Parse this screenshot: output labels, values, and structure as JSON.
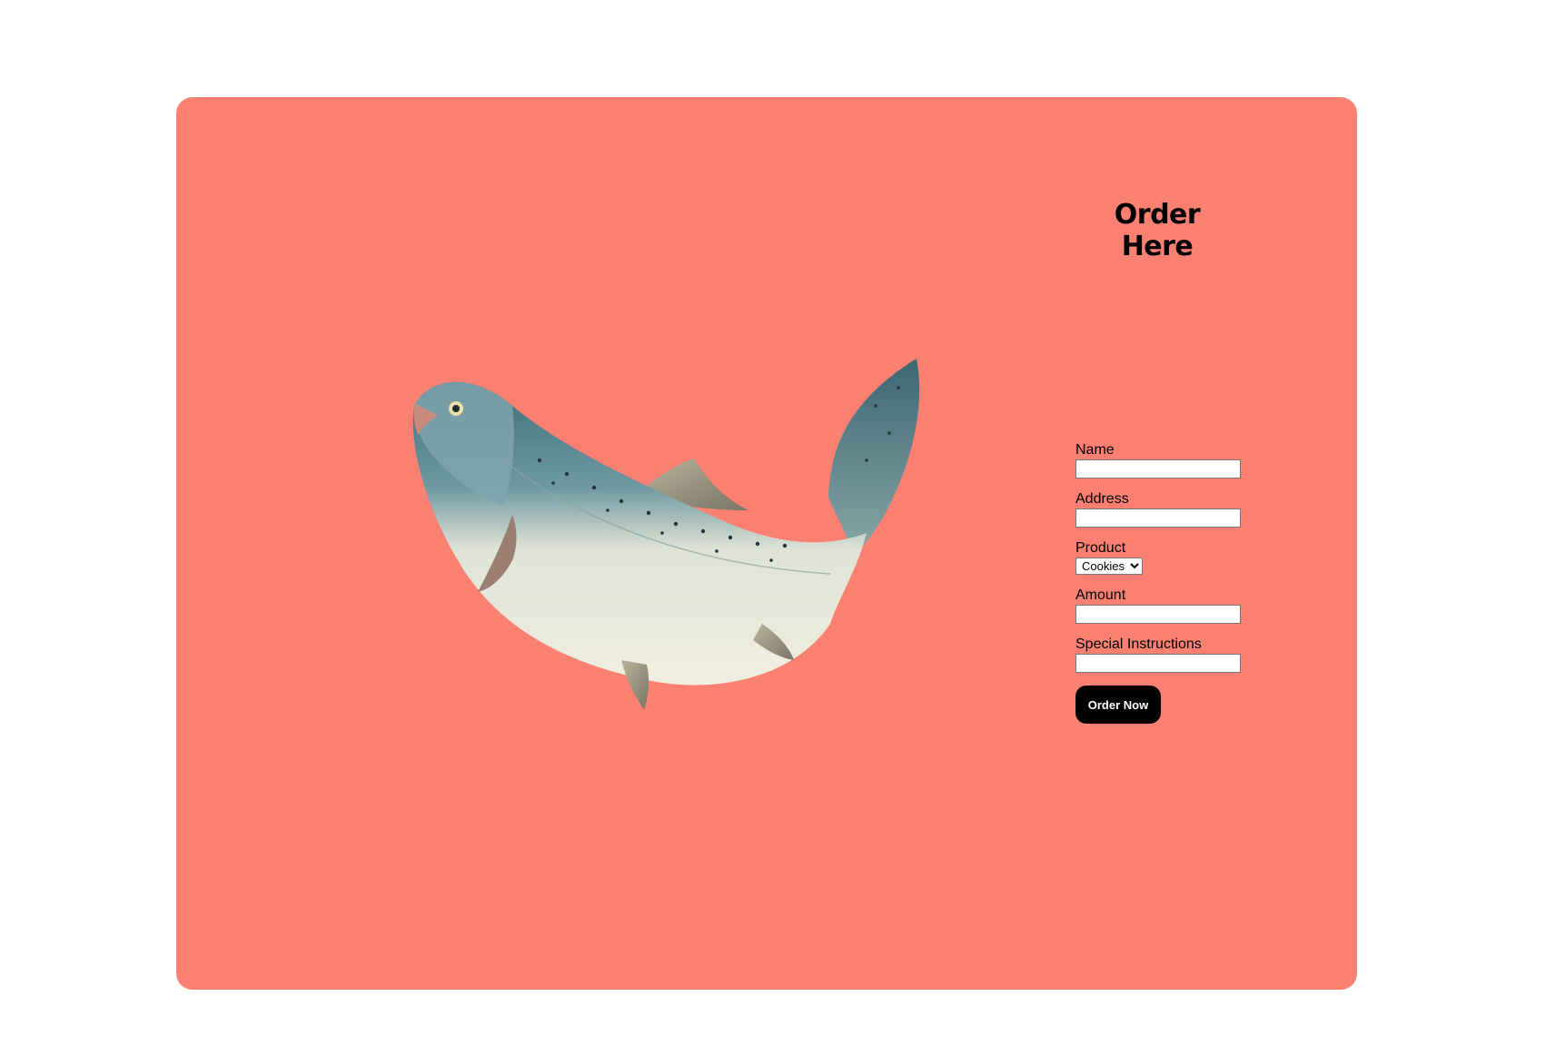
{
  "form": {
    "title": "Order Here",
    "fields": {
      "name_label": "Name",
      "name_value": "",
      "address_label": "Address",
      "address_value": "",
      "product_label": "Product",
      "product_selected": "Cookies",
      "amount_label": "Amount",
      "amount_value": "",
      "special_label": "Special Instructions",
      "special_value": ""
    },
    "submit_label": "Order Now"
  },
  "colors": {
    "card_background": "#fa8072",
    "button_background": "#000000",
    "button_text": "#ffffff"
  },
  "illustration": {
    "icon": "salmon-fish-illustration"
  }
}
